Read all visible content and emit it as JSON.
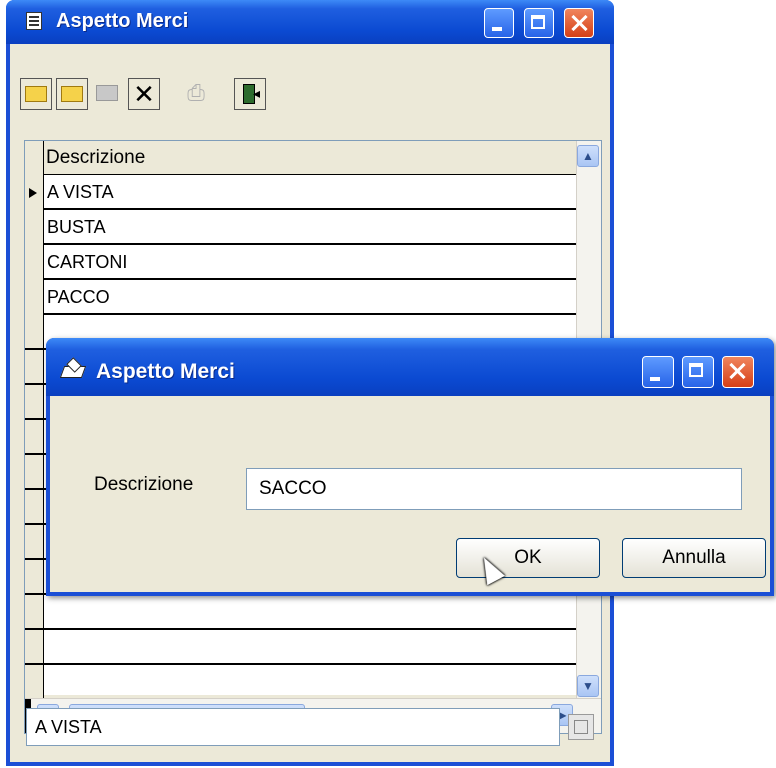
{
  "main_window": {
    "title": "Aspetto Merci",
    "grid": {
      "column_header": "Descrizione",
      "rows": [
        "A VISTA",
        "BUSTA",
        "CARTONI",
        "PACCO"
      ]
    },
    "status_value": "A VISTA"
  },
  "dialog": {
    "title": "Aspetto Merci",
    "field_label": "Descrizione",
    "field_value": "SACCO",
    "ok_label": "OK",
    "cancel_label": "Annulla"
  },
  "colors": {
    "titlebar": "#0b4ad2",
    "close_button": "#d63f16",
    "window_face": "#ece9d8",
    "input_border": "#7f9db9"
  }
}
